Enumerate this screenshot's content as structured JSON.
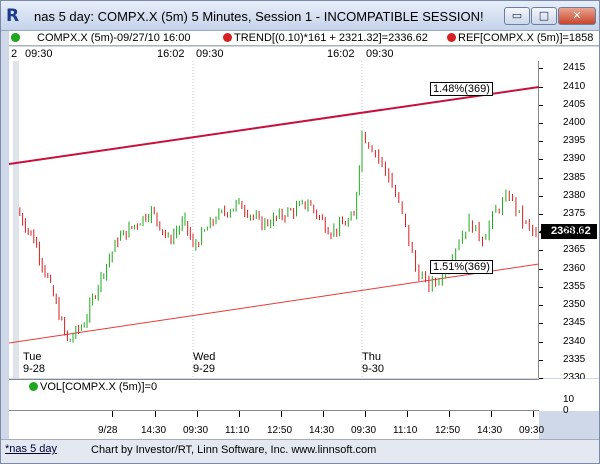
{
  "window": {
    "title": "nas 5 day: COMPX.X (5m) 5 Minutes, Session 1 - INCOMPATIBLE SESSION!",
    "app_icon": "R",
    "min_glyph": "▭",
    "max_glyph": "□",
    "close_glyph": "✕"
  },
  "legend": {
    "price": "COMPX.X (5m)-09/27/10 16:00",
    "trend": "TREND[(0.10)*161 + 2321.32]=2336.62",
    "ref": "REF[COMPX.X (5m)]=1858"
  },
  "timebar": [
    "2",
    "09:30",
    "16:02",
    "09:30",
    "16:02",
    "09:30"
  ],
  "y_axis": {
    "ticks": [
      "2415",
      "2410",
      "2405",
      "2400",
      "2395",
      "2390",
      "2385",
      "2380",
      "2375",
      "2370",
      "2365",
      "2360",
      "2355",
      "2350",
      "2345",
      "2340",
      "2335",
      "2330"
    ],
    "last_price": "2368.62"
  },
  "annotations": {
    "upper_pct": "1.48%(369)",
    "lower_pct": "1.51%(369)"
  },
  "days": [
    {
      "dow": "Tue",
      "date": "9-28"
    },
    {
      "dow": "Wed",
      "date": "9-29"
    },
    {
      "dow": "Thu",
      "date": "9-30"
    }
  ],
  "volume": {
    "legend": "VOL[COMPX.X (5m)]=0",
    "axis_top": "10",
    "axis_bottom": "0"
  },
  "x_axis": [
    "9/28",
    "14:30",
    "09:30",
    "11:10",
    "12:50",
    "14:30",
    "09:30",
    "11:10",
    "12:50",
    "14:30",
    "09:30"
  ],
  "footer": {
    "tab": "*nas 5 day",
    "credit": "Chart by Investor/RT, Linn Software, Inc. www.linnsoft.com"
  },
  "colors": {
    "up": "#1fa81f",
    "down": "#d42020",
    "upper_trend": "#c8103c",
    "lower_trend": "#e83a3a"
  },
  "chart_data": {
    "type": "line",
    "x": [
      "9/28 09:30",
      "9/28 09:45",
      "9/28 10:00",
      "9/28 10:15",
      "9/28 10:30",
      "9/28 11:00",
      "9/28 12:00",
      "9/28 13:00",
      "9/28 14:00",
      "9/28 15:00",
      "9/28 16:00",
      "9/29 09:30",
      "9/29 10:30",
      "9/29 11:30",
      "9/29 12:30",
      "9/29 13:30",
      "9/29 14:30",
      "9/29 15:30",
      "9/29 16:00",
      "9/30 09:30",
      "9/30 10:00",
      "9/30 10:30",
      "9/30 11:00",
      "9/30 11:30",
      "9/30 12:00",
      "9/30 12:30",
      "9/30 13:00",
      "9/30 13:30",
      "9/30 14:00",
      "9/30 14:30",
      "9/30 15:00",
      "9/30 15:30",
      "9/30 16:00"
    ],
    "series": [
      {
        "name": "COMPX.X (5m)",
        "values": [
          2376,
          2368,
          2355,
          2340,
          2345,
          2358,
          2368,
          2372,
          2376,
          2368,
          2373,
          2366,
          2374,
          2378,
          2372,
          2375,
          2378,
          2370,
          2374,
          2397,
          2392,
          2385,
          2375,
          2360,
          2355,
          2358,
          2366,
          2373,
          2368,
          2376,
          2380,
          2373,
          2369
        ]
      }
    ],
    "ylim": [
      2330,
      2417
    ],
    "grid": false
  }
}
